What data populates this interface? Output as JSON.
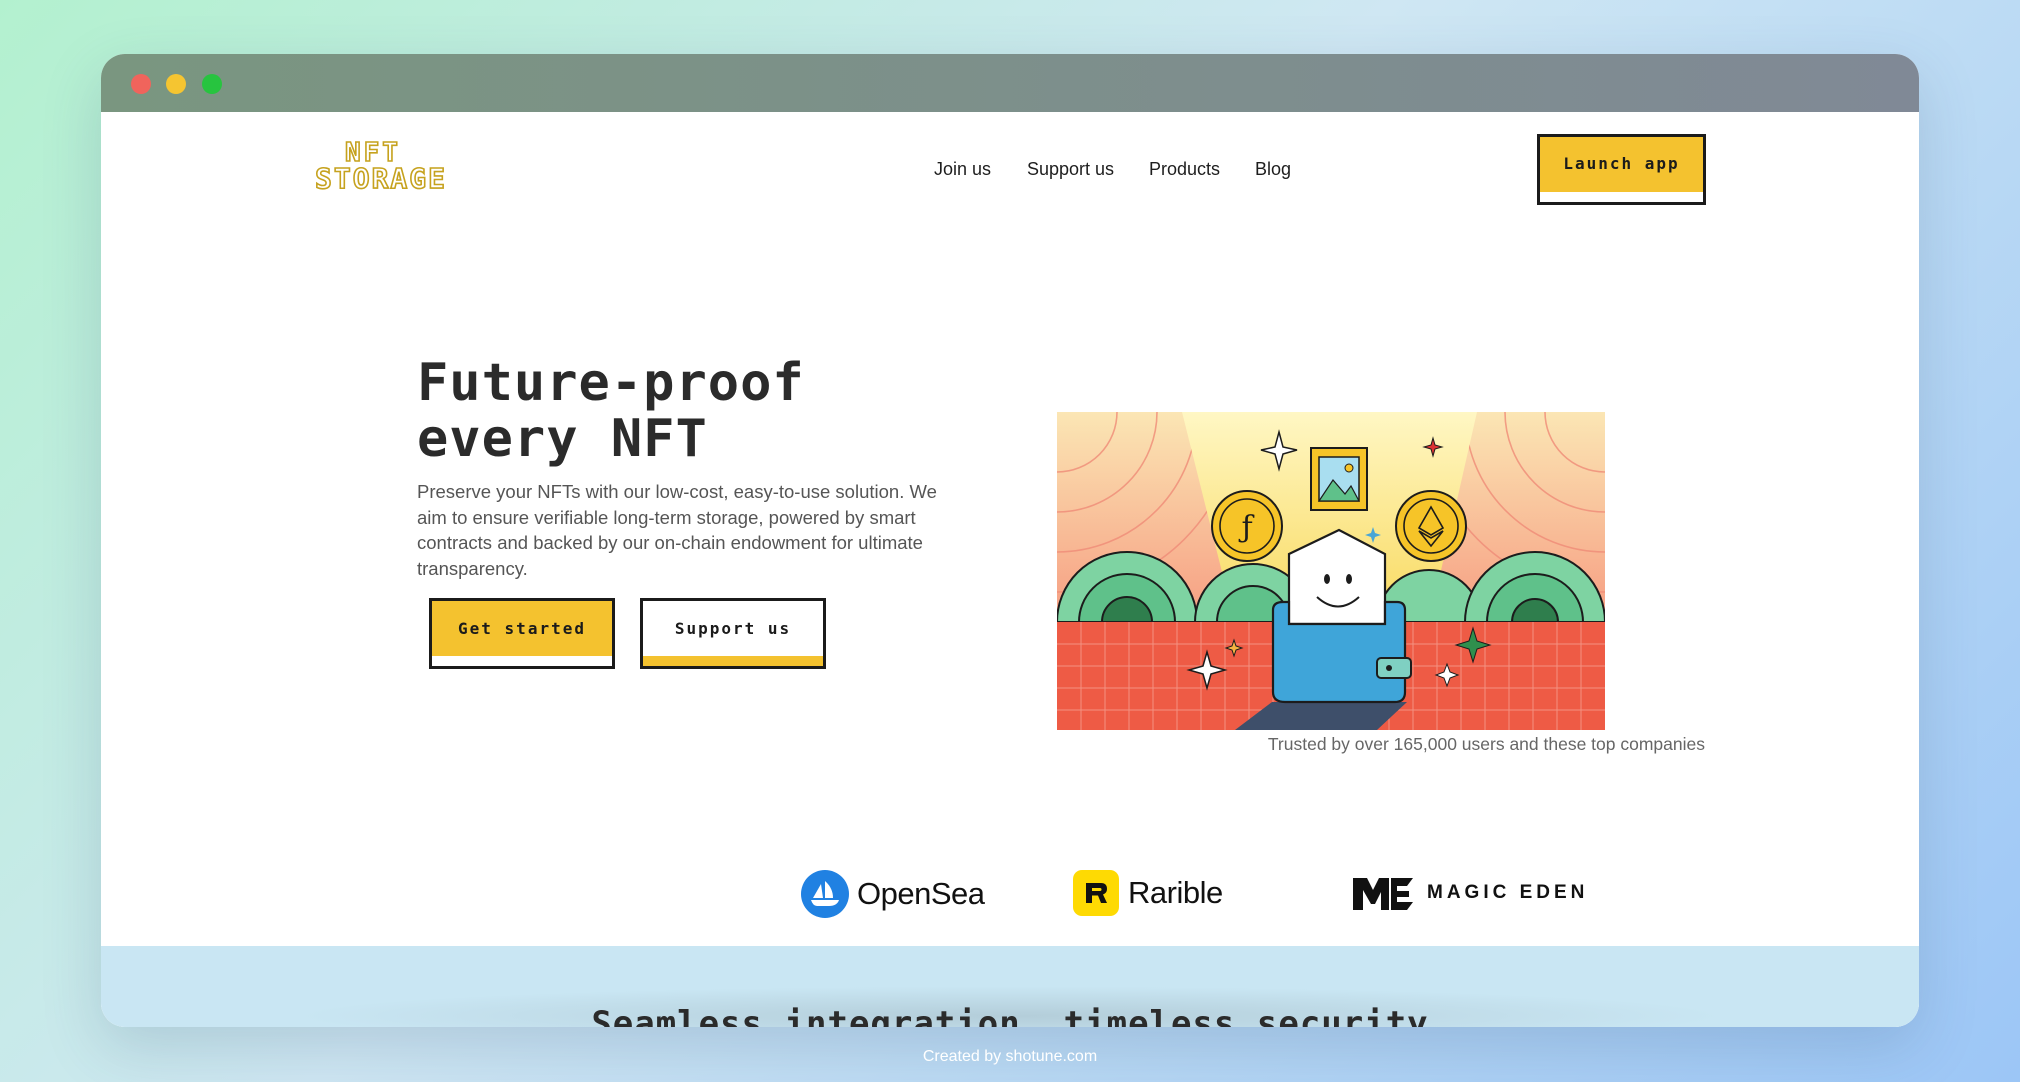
{
  "window": {
    "controls": [
      "close",
      "minimize",
      "zoom"
    ]
  },
  "header": {
    "logo_line1": "NFT",
    "logo_line2": "STORAGE",
    "nav": [
      "Join us",
      "Support us",
      "Products",
      "Blog"
    ],
    "launch_label": "Launch app"
  },
  "hero": {
    "title_line1": "Future-proof",
    "title_line2": "every NFT",
    "description": "Preserve your NFTs with our low-cost, easy-to-use solution. We aim to ensure verifiable long-term storage, powered by smart contracts and backed by our on-chain endowment for ultimate transparency.",
    "primary_cta": "Get started",
    "secondary_cta": "Support us"
  },
  "trusted": {
    "text": "Trusted by over 165,000 users and these top companies",
    "companies": [
      "OpenSea",
      "Rarible",
      "MAGIC EDEN"
    ]
  },
  "next_section": {
    "title": "Seamless integration, timeless security"
  },
  "footer_credit": "Created by shotune.com",
  "colors": {
    "accent": "#f4c22f",
    "ink": "#1b1b1b",
    "opensea": "#2081e2",
    "rarible": "#feda03"
  }
}
